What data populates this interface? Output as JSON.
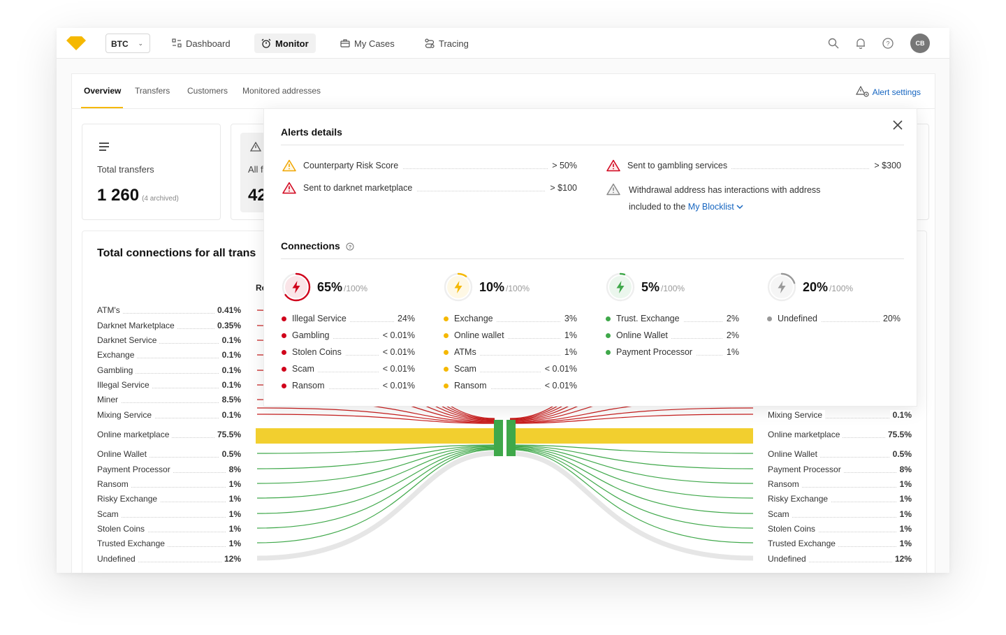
{
  "topnav": {
    "coin": "BTC",
    "items": [
      {
        "label": "Dashboard",
        "icon": "dashboard-icon"
      },
      {
        "label": "Monitor",
        "icon": "alarm-icon"
      },
      {
        "label": "My Cases",
        "icon": "briefcase-icon"
      },
      {
        "label": "Tracing",
        "icon": "route-icon"
      }
    ],
    "active": "Monitor",
    "avatar": "CB"
  },
  "tabs": {
    "items": [
      "Overview",
      "Transfers",
      "Customers",
      "Monitored addresses"
    ],
    "active": "Overview",
    "alert_settings": "Alert settings"
  },
  "cards": {
    "total_transfers": {
      "title": "Total transfers",
      "value": "1 260",
      "note": "(4 archived)"
    },
    "second": {
      "title": "All f",
      "value": "42"
    }
  },
  "connections_chart": {
    "title": "Total connections for all trans",
    "column_label": "Re",
    "left_items": [
      {
        "label": "ATM's",
        "value": "0.41%"
      },
      {
        "label": "Darknet Marketplace",
        "value": "0.35%"
      },
      {
        "label": "Darknet Service",
        "value": "0.1%"
      },
      {
        "label": "Exchange",
        "value": "0.1%"
      },
      {
        "label": "Gambling",
        "value": "0.1%"
      },
      {
        "label": "Illegal Service",
        "value": "0.1%"
      },
      {
        "label": "Miner",
        "value": "8.5%"
      },
      {
        "label": "Mixing Service",
        "value": "0.1%"
      },
      {
        "label": "Online marketplace",
        "value": "75.5%"
      },
      {
        "label": "Online Wallet",
        "value": "0.5%"
      },
      {
        "label": "Payment Processor",
        "value": "8%"
      },
      {
        "label": "Ransom",
        "value": "1%"
      },
      {
        "label": "Risky Exchange",
        "value": "1%"
      },
      {
        "label": "Scam",
        "value": "1%"
      },
      {
        "label": "Stolen Coins",
        "value": "1%"
      },
      {
        "label": "Trusted Exchange",
        "value": "1%"
      },
      {
        "label": "Undefined",
        "value": "12%"
      }
    ],
    "right_items": [
      {
        "label": "Mixing Service",
        "value": "0.1%"
      },
      {
        "label": "Online marketplace",
        "value": "75.5%"
      },
      {
        "label": "Online Wallet",
        "value": "0.5%"
      },
      {
        "label": "Payment Processor",
        "value": "8%"
      },
      {
        "label": "Ransom",
        "value": "1%"
      },
      {
        "label": "Risky Exchange",
        "value": "1%"
      },
      {
        "label": "Scam",
        "value": "1%"
      },
      {
        "label": "Stolen Coins",
        "value": "1%"
      },
      {
        "label": "Trusted Exchange",
        "value": "1%"
      },
      {
        "label": "Undefined",
        "value": "12%"
      }
    ]
  },
  "modal": {
    "title": "Alerts details",
    "alerts": [
      {
        "label": "Counterparty Risk Score",
        "value": "> 50%",
        "level": "warning"
      },
      {
        "label": "Sent to gambling services",
        "value": "> $300",
        "level": "danger"
      },
      {
        "label": "Sent to darknet marketplace",
        "value": "> $100",
        "level": "danger"
      }
    ],
    "blocklist_alert": {
      "line1": "Withdrawal address has interactions with address",
      "line2": "included to the ",
      "link": "My Blocklist"
    },
    "connections_title": "Connections",
    "connections": [
      {
        "percent": "65%",
        "of": "/100%",
        "color": "#d0021b",
        "fill": 0.65,
        "items": [
          {
            "label": "Illegal Service",
            "value": "24%"
          },
          {
            "label": "Gambling",
            "value": "< 0.01%"
          },
          {
            "label": "Stolen Coins",
            "value": "< 0.01%"
          },
          {
            "label": "Scam",
            "value": "< 0.01%"
          },
          {
            "label": "Ransom",
            "value": "< 0.01%"
          }
        ]
      },
      {
        "percent": "10%",
        "of": "/100%",
        "color": "#f5b800",
        "fill": 0.1,
        "items": [
          {
            "label": "Exchange",
            "value": "3%"
          },
          {
            "label": "Online wallet",
            "value": "1%"
          },
          {
            "label": "ATMs",
            "value": "1%"
          },
          {
            "label": "Scam",
            "value": "< 0.01%"
          },
          {
            "label": "Ransom",
            "value": "< 0.01%"
          }
        ]
      },
      {
        "percent": "5%",
        "of": "/100%",
        "color": "#3fa84a",
        "fill": 0.05,
        "items": [
          {
            "label": "Trust. Exchange",
            "value": "2%"
          },
          {
            "label": "Online Wallet",
            "value": "2%"
          },
          {
            "label": "Payment Processor",
            "value": "1%"
          }
        ]
      },
      {
        "percent": "20%",
        "of": "/100%",
        "color": "#999999",
        "fill": 0.2,
        "items": [
          {
            "label": "Undefined",
            "value": "20%"
          }
        ]
      }
    ]
  }
}
